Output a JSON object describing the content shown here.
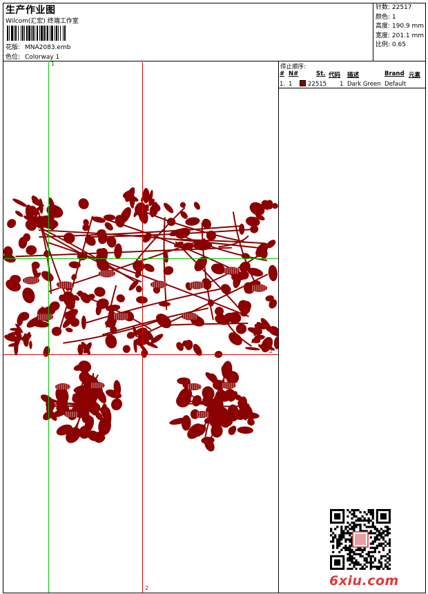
{
  "header": {
    "title": "生产作业图",
    "software": "Wilcom(汇宏) 终端工作室",
    "design_label": "花版:",
    "design_value": "MNA2083.emb",
    "colorway_label": "色位:",
    "colorway_value": "Colorway 1"
  },
  "info": {
    "stitches": "针数: 22517",
    "colors": "颜色: 1",
    "height": "高度: 190.9 mm",
    "width": "宽度: 201.1 mm",
    "scale": "比例: 0.65"
  },
  "stop_sequence": {
    "caption": "停止顺序:",
    "headers": [
      "#",
      "N#",
      "St.",
      "代码",
      "描述",
      "Brand",
      "元素"
    ],
    "rows": [
      {
        "index": "1.",
        "needle": "1",
        "swatch": "#8b0000",
        "stitches": "22515",
        "code": "1",
        "description": "Dark Green",
        "brand": "Default",
        "element": ""
      }
    ]
  },
  "guides": {
    "green_1": "1",
    "green_2": "1",
    "red_1": "2",
    "red_2": "2"
  },
  "colors": {
    "embroidery": "#8b0000",
    "guide_green": "#00cc00",
    "guide_red": "#e00000",
    "watermark": "#e23a3a"
  },
  "watermark": {
    "text": "6xiu.com"
  }
}
